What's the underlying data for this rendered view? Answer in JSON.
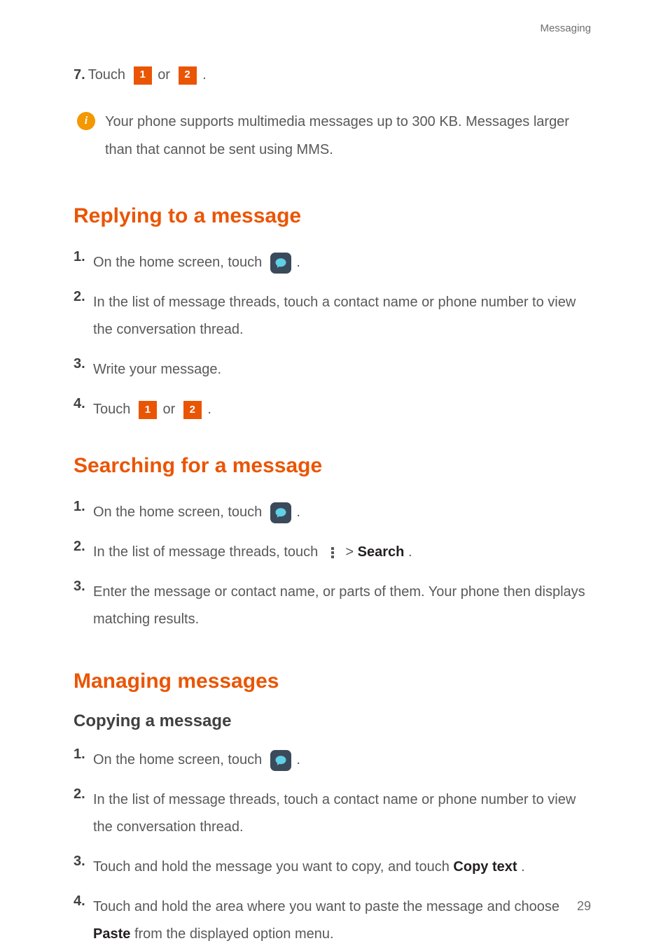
{
  "runningHead": "Messaging",
  "s7": {
    "num": "7.",
    "t1": "Touch ",
    "or": " or ",
    "t2": " .",
    "sim1": "1",
    "sim2": "2"
  },
  "note": {
    "glyph": "i",
    "text": "Your phone supports multimedia messages up to 300 KB. Messages larger than that cannot be sent using MMS."
  },
  "reply": {
    "heading": "Replying to a message",
    "steps": {
      "s1": {
        "num": "1.",
        "t1": "On the home screen, touch ",
        "t2": " ."
      },
      "s2": {
        "num": "2.",
        "text": "In the list of message threads, touch a contact name or phone number to view the conversation thread."
      },
      "s3": {
        "num": "3.",
        "text": "Write your message."
      },
      "s4": {
        "num": "4.",
        "t1": "Touch ",
        "or": " or ",
        "t2": " .",
        "sim1": "1",
        "sim2": "2"
      }
    }
  },
  "search": {
    "heading": "Searching for a message",
    "steps": {
      "s1": {
        "num": "1.",
        "t1": "On the home screen, touch ",
        "t2": " ."
      },
      "s2": {
        "num": "2.",
        "t1": "In the list of message threads, touch ",
        "gt": "  > ",
        "bold": "Search",
        "t2": "."
      },
      "s3": {
        "num": "3.",
        "text": "Enter the message or contact name, or parts of them. Your phone then displays matching results."
      }
    }
  },
  "manage": {
    "heading": "Managing messages",
    "sub": "Copying  a  message",
    "steps": {
      "s1": {
        "num": "1.",
        "t1": "On the home screen, touch ",
        "t2": " ."
      },
      "s2": {
        "num": "2.",
        "text": "In the list of message threads, touch a contact name or phone number to view the conversation thread."
      },
      "s3": {
        "num": "3.",
        "t1": "Touch and hold the message you want to copy, and touch ",
        "bold": "Copy text",
        "t2": "."
      },
      "s4": {
        "num": "4.",
        "t1": "Touch and hold the area where you want to paste the message and choose ",
        "bold": "Paste",
        "t2": " from the displayed option menu."
      }
    }
  },
  "pageNumber": "29"
}
